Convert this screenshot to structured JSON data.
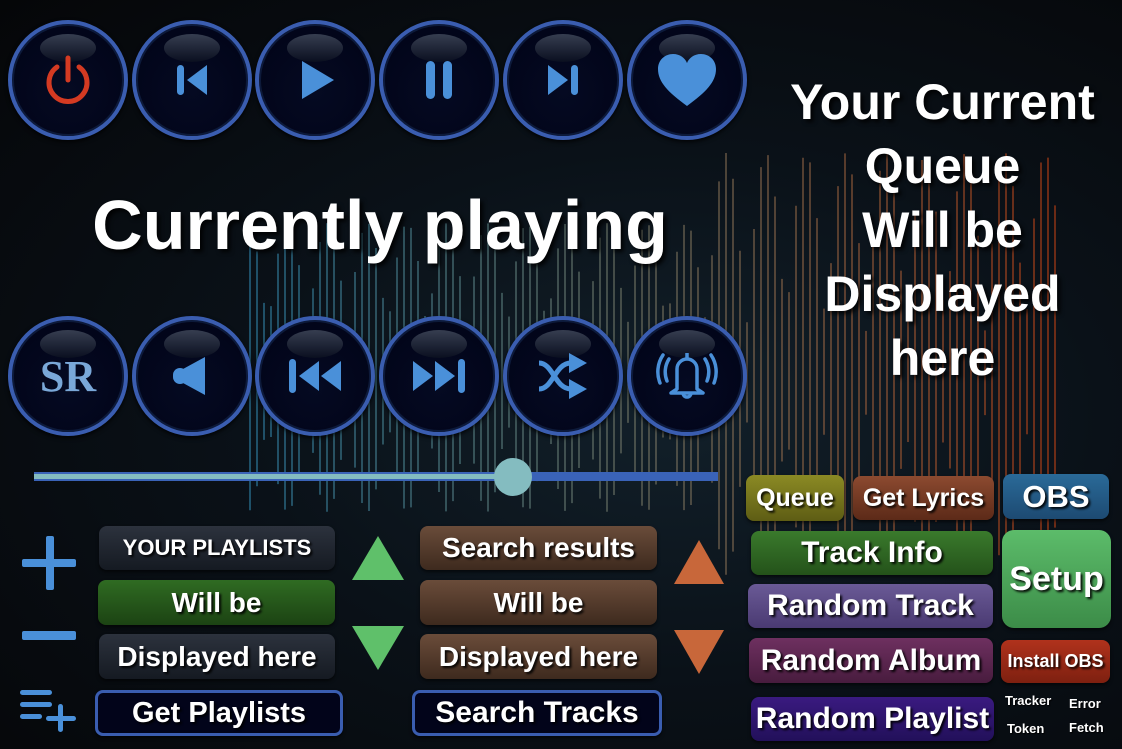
{
  "top_controls": [
    {
      "name": "power",
      "icon": "power-icon"
    },
    {
      "name": "previous",
      "icon": "skip-back-icon"
    },
    {
      "name": "play",
      "icon": "play-icon"
    },
    {
      "name": "pause",
      "icon": "pause-icon"
    },
    {
      "name": "next",
      "icon": "skip-forward-icon"
    },
    {
      "name": "like",
      "icon": "heart-icon"
    }
  ],
  "bottom_controls": [
    {
      "name": "sr",
      "label": "SR"
    },
    {
      "name": "volume",
      "icon": "speaker-icon"
    },
    {
      "name": "rewind",
      "icon": "rewind-icon"
    },
    {
      "name": "fast-forward",
      "icon": "fast-forward-icon"
    },
    {
      "name": "shuffle",
      "icon": "shuffle-icon"
    },
    {
      "name": "alerts",
      "icon": "bell-icon"
    }
  ],
  "now_playing": {
    "title": "Currently playing"
  },
  "queue": {
    "lines": [
      "Your Current",
      "Queue",
      "Will be",
      "Displayed",
      "here"
    ]
  },
  "progress": {
    "fraction": 0.7
  },
  "playlists": {
    "header": "YOUR PLAYLISTS",
    "item1": "Will be",
    "item2": "Displayed here",
    "get_button": "Get Playlists"
  },
  "search": {
    "header": "Search results",
    "item1": "Will be",
    "item2": "Displayed here",
    "search_button": "Search Tracks"
  },
  "actions": {
    "queue": "Queue",
    "get_lyrics": "Get Lyrics",
    "obs": "OBS",
    "track_info": "Track Info",
    "setup": "Setup",
    "random_track": "Random Track",
    "random_album": "Random Album",
    "install_obs": "Install OBS",
    "random_playlist": "Random Playlist",
    "tracker": "Tracker",
    "error": "Error",
    "token": "Token",
    "fetch": "Fetch"
  },
  "colors": {
    "accent": "#3a5db0",
    "icon": "#4a90d9",
    "power": "#d43a22",
    "green_arrow": "#5fc06a",
    "orange_arrow": "#c8673a"
  }
}
